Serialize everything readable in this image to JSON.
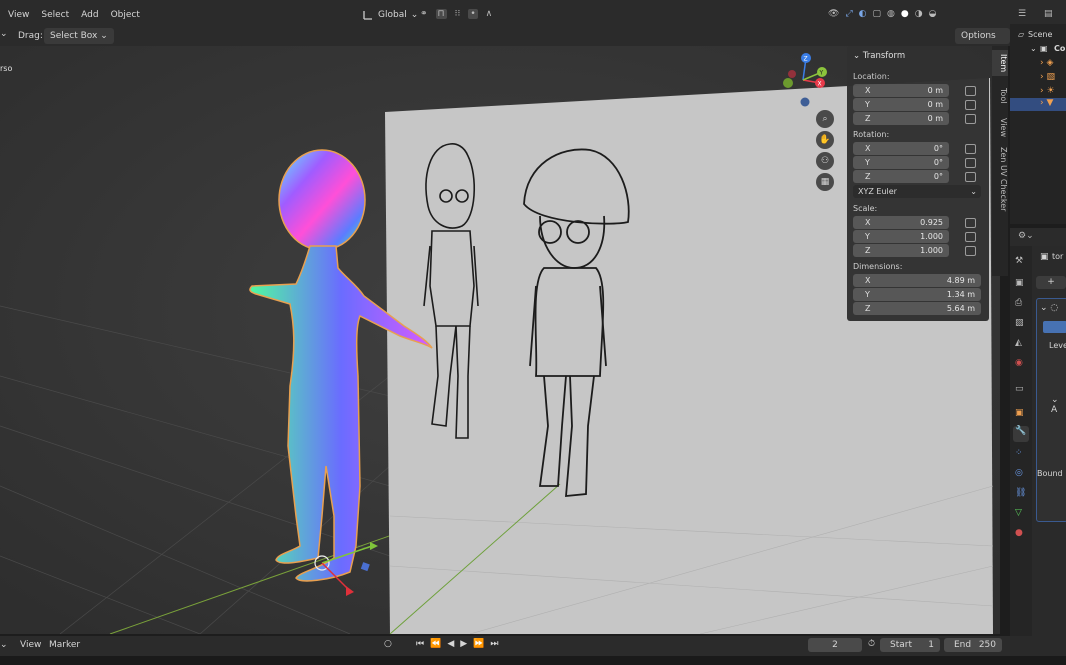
{
  "header": {
    "menu": [
      "View",
      "Select",
      "Add",
      "Object"
    ],
    "transform_orientation": "Global",
    "drag_label": "Drag:",
    "drag_value": "Select Box",
    "options_label": "Options"
  },
  "viewport": {
    "object_label": "rso"
  },
  "npanel": {
    "section_title": "Transform",
    "location_label": "Location:",
    "location": [
      {
        "axis": "X",
        "value": "0 m"
      },
      {
        "axis": "Y",
        "value": "0 m"
      },
      {
        "axis": "Z",
        "value": "0 m"
      }
    ],
    "rotation_label": "Rotation:",
    "rotation": [
      {
        "axis": "X",
        "value": "0°"
      },
      {
        "axis": "Y",
        "value": "0°"
      },
      {
        "axis": "Z",
        "value": "0°"
      }
    ],
    "rotation_mode": "XYZ Euler",
    "scale_label": "Scale:",
    "scale": [
      {
        "axis": "X",
        "value": "0.925"
      },
      {
        "axis": "Y",
        "value": "1.000"
      },
      {
        "axis": "Z",
        "value": "1.000"
      }
    ],
    "dimensions_label": "Dimensions:",
    "dimensions": [
      {
        "axis": "X",
        "value": "4.89 m"
      },
      {
        "axis": "Y",
        "value": "1.34 m"
      },
      {
        "axis": "Z",
        "value": "5.64 m"
      }
    ]
  },
  "vtabs": [
    "Item",
    "Tool",
    "View",
    "Zen UV Checker"
  ],
  "gizmo": {
    "x": "X",
    "y": "Y",
    "z": "Z"
  },
  "outliner": {
    "scene_label": "Scene",
    "collection_label": "Co"
  },
  "properties": {
    "object_name": "tor",
    "level_label": "Leve",
    "bound_label": "Bound"
  },
  "timeline": {
    "menu": [
      "View",
      "Marker"
    ],
    "current_frame": "2",
    "start_label": "Start",
    "start_value": "1",
    "end_label": "End",
    "end_value": "250"
  },
  "colors": {
    "accent": "#4772b3",
    "selected_outline": "#e8a050",
    "axis_x": "#e83a4a",
    "axis_y": "#8cc43c",
    "axis_z": "#3a7ee8"
  }
}
